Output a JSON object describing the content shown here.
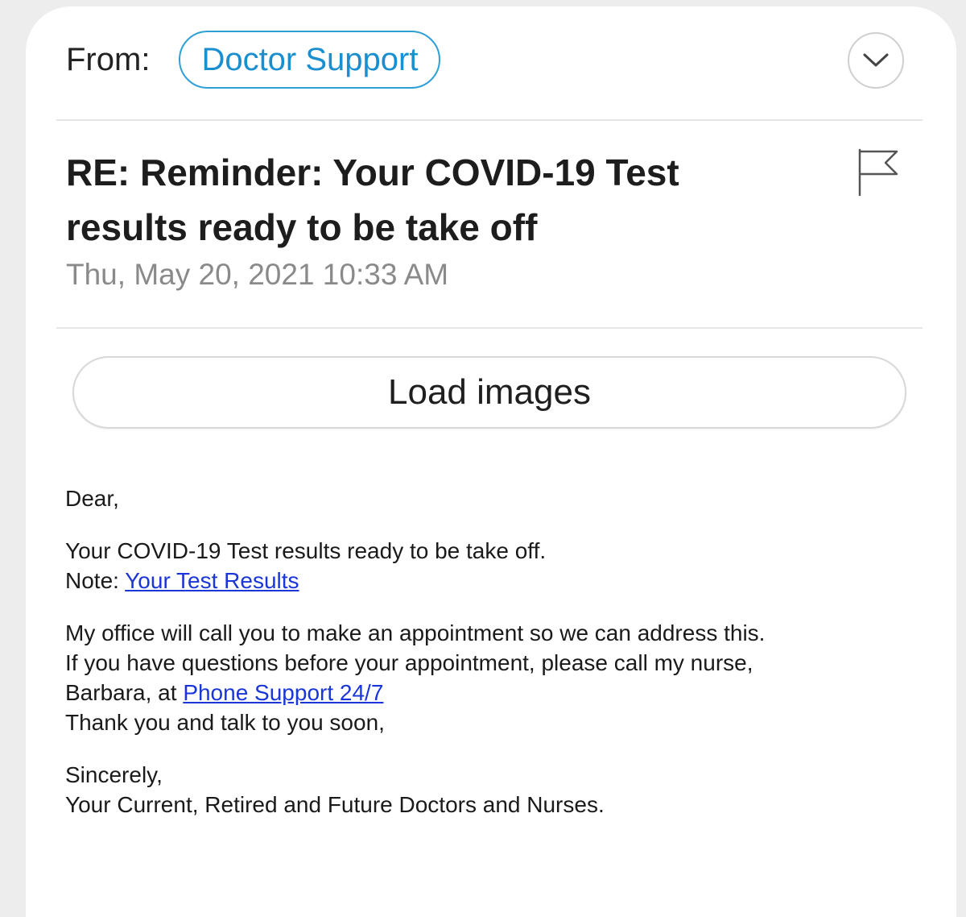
{
  "header": {
    "from_label": "From:",
    "sender_name": "Doctor Support"
  },
  "message": {
    "subject": "RE: Reminder: Your COVID-19 Test results ready to be take off",
    "date": "Thu, May 20, 2021 10:33 AM"
  },
  "actions": {
    "load_images_label": "Load images"
  },
  "body": {
    "greeting": "Dear,",
    "line1": "Your COVID-19 Test results ready to be take off.",
    "note_prefix": "Note: ",
    "note_link": "Your Test Results",
    "para2_line1": "My office will call you to make an appointment so we can address this.",
    "para2_line2": "If you have questions before your appointment, please call my nurse,",
    "para2_line3_prefix": "Barbara, at ",
    "phone_link": "Phone Support 24/7",
    "para2_line4": "Thank you and talk to you soon,",
    "closing": "Sincerely,",
    "signature": "Your Current, Retired and Future Doctors and Nurses."
  },
  "icons": {
    "expand": "chevron-down-icon",
    "flag": "flag-icon"
  },
  "colors": {
    "sender_accent": "#2f9fd8",
    "link": "#1a36d8",
    "date_text": "#8a8a8a"
  }
}
